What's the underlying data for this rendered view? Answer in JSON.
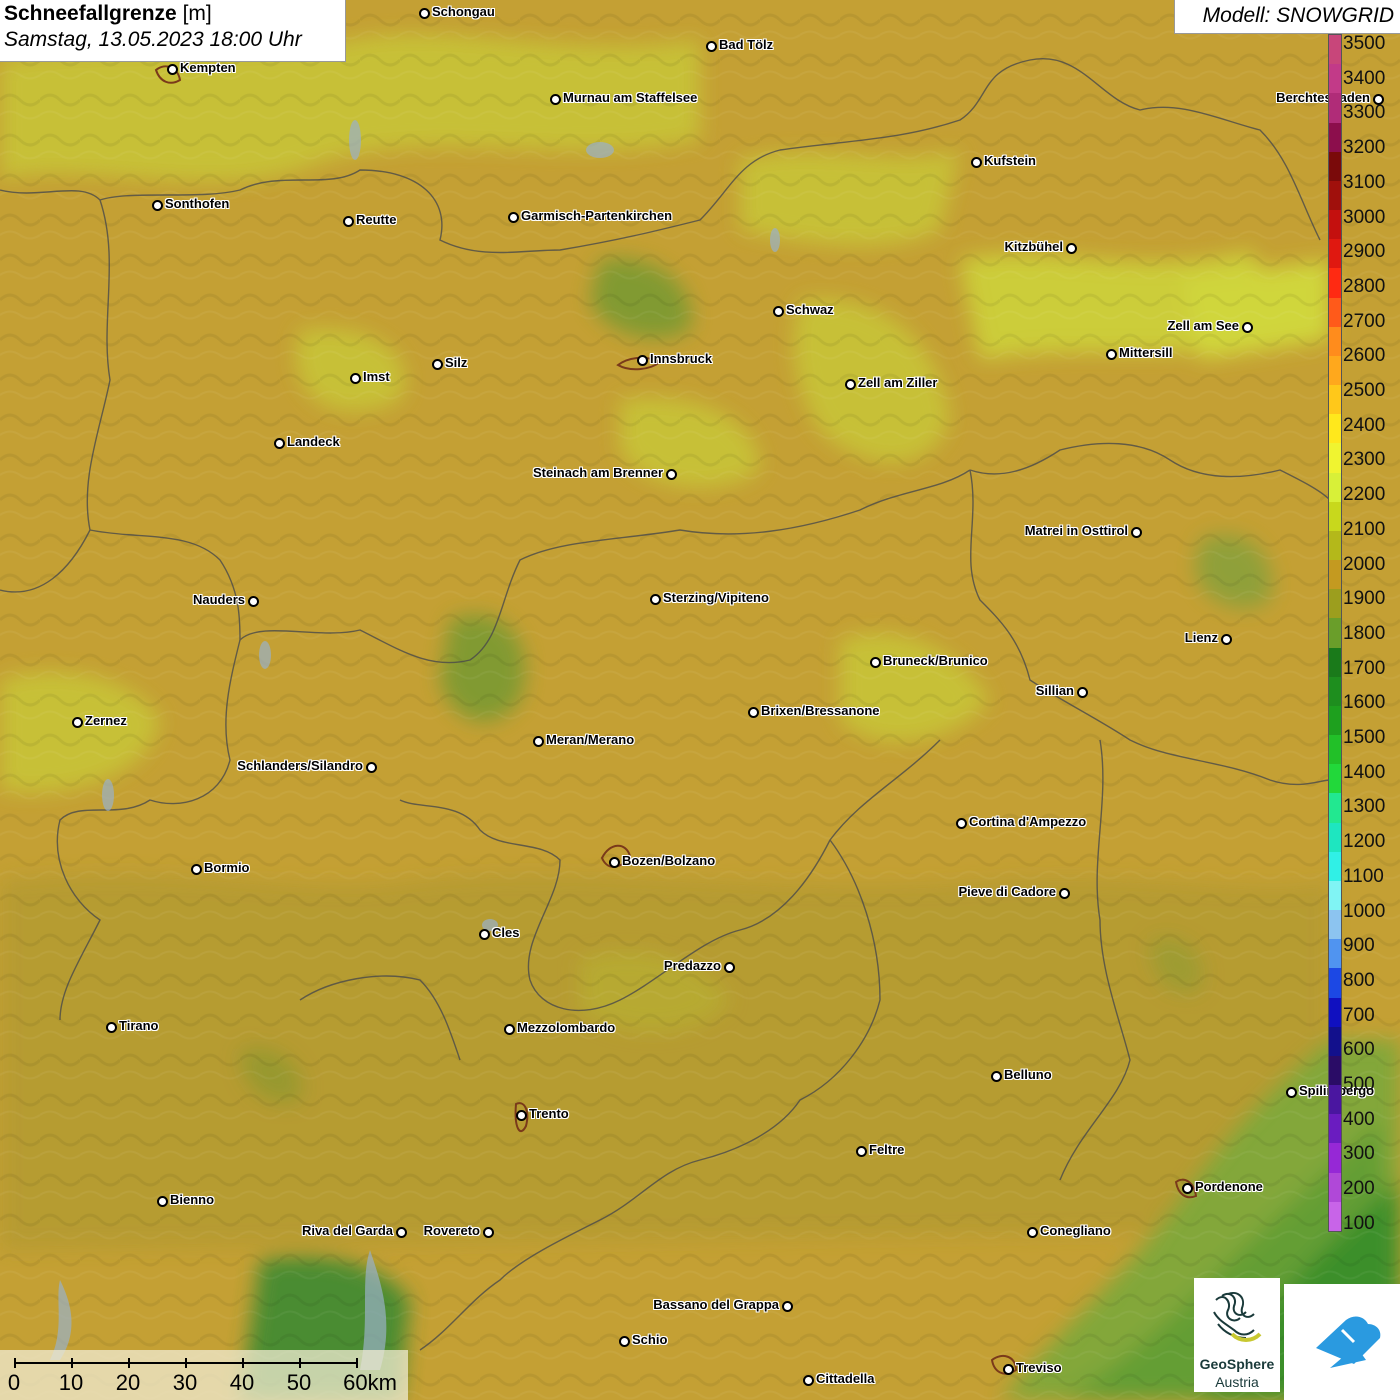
{
  "header": {
    "title_bold": "Schneefallgrenze",
    "title_unit": " [m]",
    "subtitle": "Samstag, 13.05.2023 18:00 Uhr",
    "model": "Modell: SNOWGRID"
  },
  "legend": {
    "colors": [
      "#c8467a",
      "#c23a88",
      "#b02c78",
      "#8c0e4c",
      "#7a0a0a",
      "#a0100c",
      "#c4100e",
      "#e01810",
      "#ff2a12",
      "#ff5a1a",
      "#ff8c1c",
      "#ffa81c",
      "#ffc81a",
      "#ffe81c",
      "#f0f430",
      "#d8f038",
      "#c8d81c",
      "#b4b81a",
      "#c49a20",
      "#9c9e1e",
      "#6a9e2a",
      "#1a7a1a",
      "#1e8e1e",
      "#1ea01e",
      "#22c028",
      "#22d83a",
      "#22e890",
      "#1ee6c0",
      "#30f0e6",
      "#80f4f4",
      "#8cc4f0",
      "#5094f0",
      "#1c48e4",
      "#1010c0",
      "#12108c",
      "#2a0c66",
      "#4a16a0",
      "#6a1cc0",
      "#9628d6",
      "#b048d8",
      "#c864e8"
    ],
    "labels": [
      "3500",
      "3400",
      "3300",
      "3200",
      "3100",
      "3000",
      "2900",
      "2800",
      "2700",
      "2600",
      "2500",
      "2400",
      "2300",
      "2200",
      "2100",
      "2000",
      "1900",
      "1800",
      "1700",
      "1600",
      "1500",
      "1400",
      "1300",
      "1200",
      "1100",
      "1000",
      "900",
      "800",
      "700",
      "600",
      "500",
      "400",
      "300",
      "200",
      "100"
    ]
  },
  "cities": [
    {
      "name": "Schongau",
      "side": "r"
    },
    {
      "name": "Bad Tölz",
      "side": "r"
    },
    {
      "name": "Kempten",
      "side": "r"
    },
    {
      "name": "Murnau am Staffelsee",
      "side": "r"
    },
    {
      "name": "Berchtesgaden",
      "side": "l"
    },
    {
      "name": "Kufstein",
      "side": "r"
    },
    {
      "name": "Sonthofen",
      "side": "r"
    },
    {
      "name": "Reutte",
      "side": "r"
    },
    {
      "name": "Garmisch-Partenkirchen",
      "side": "r"
    },
    {
      "name": "Kitzbühel",
      "side": "l"
    },
    {
      "name": "Schwaz",
      "side": "r"
    },
    {
      "name": "Zell am See",
      "side": "l"
    },
    {
      "name": "Innsbruck",
      "side": "r"
    },
    {
      "name": "Mittersill",
      "side": "r"
    },
    {
      "name": "Silz",
      "side": "r"
    },
    {
      "name": "Imst",
      "side": "r"
    },
    {
      "name": "Zell am Ziller",
      "side": "r"
    },
    {
      "name": "Landeck",
      "side": "r"
    },
    {
      "name": "Steinach am Brenner",
      "side": "l"
    },
    {
      "name": "Matrei in Osttirol",
      "side": "l"
    },
    {
      "name": "Nauders",
      "side": "l"
    },
    {
      "name": "Sterzing/Vipiteno",
      "side": "r"
    },
    {
      "name": "Lienz",
      "side": "l"
    },
    {
      "name": "Bruneck/Brunico",
      "side": "r"
    },
    {
      "name": "Sillian",
      "side": "l"
    },
    {
      "name": "Brixen/Bressanone",
      "side": "r"
    },
    {
      "name": "Zernez",
      "side": "r"
    },
    {
      "name": "Meran/Merano",
      "side": "r"
    },
    {
      "name": "Schlanders/Silandro",
      "side": "l"
    },
    {
      "name": "Cortina d'Ampezzo",
      "side": "r"
    },
    {
      "name": "Bozen/Bolzano",
      "side": "r"
    },
    {
      "name": "Bormio",
      "side": "r"
    },
    {
      "name": "Pieve di Cadore",
      "side": "l"
    },
    {
      "name": "Cles",
      "side": "r"
    },
    {
      "name": "Predazzo",
      "side": "l"
    },
    {
      "name": "Tirano",
      "side": "r"
    },
    {
      "name": "Mezzolombardo",
      "side": "r"
    },
    {
      "name": "Belluno",
      "side": "r"
    },
    {
      "name": "Spilimbergo",
      "side": "r"
    },
    {
      "name": "Trento",
      "side": "r"
    },
    {
      "name": "Feltre",
      "side": "r"
    },
    {
      "name": "Pordenone",
      "side": "r"
    },
    {
      "name": "Bienno",
      "side": "r"
    },
    {
      "name": "Riva del Garda",
      "side": "l"
    },
    {
      "name": "Rovereto",
      "side": "l"
    },
    {
      "name": "Conegliano",
      "side": "r"
    },
    {
      "name": "Bassano del Grappa",
      "side": "l"
    },
    {
      "name": "Schio",
      "side": "r"
    },
    {
      "name": "Treviso",
      "side": "r"
    },
    {
      "name": "Cittadella",
      "side": "r"
    }
  ],
  "scalebar": {
    "labels": [
      "0",
      "10",
      "20",
      "30",
      "40",
      "50",
      "60km"
    ]
  },
  "logos": {
    "geosphere_name": "GeoSphere",
    "geosphere_sub": "Austria"
  }
}
